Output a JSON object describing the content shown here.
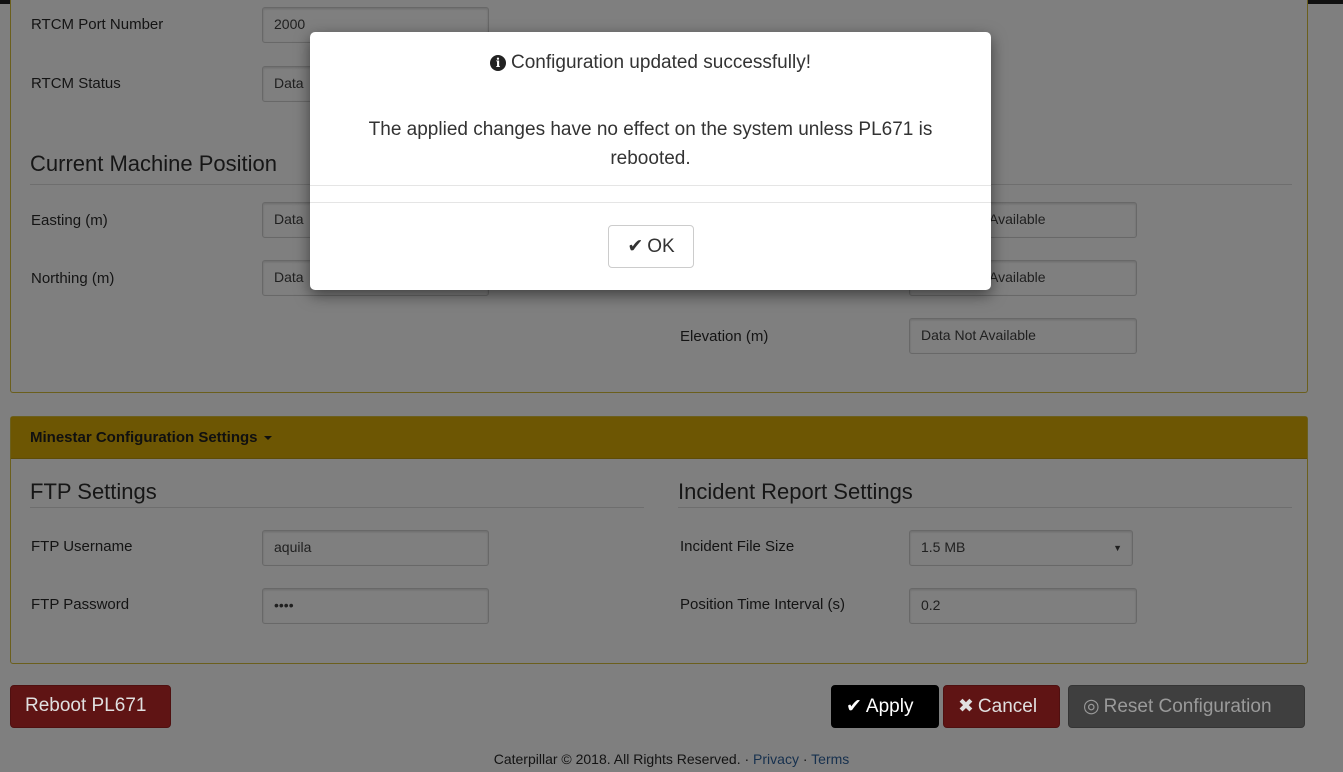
{
  "top_panel": {
    "rtcm_port_label": "RTCM Port Number",
    "rtcm_port_value": "2000",
    "rtcm_status_label": "RTCM Status",
    "rtcm_status_value": "Data",
    "position_title": "Current Machine Position",
    "easting_label": "Easting (m)",
    "easting_value": "Data",
    "northing_label": "Northing (m)",
    "northing_value": "Data",
    "right_value_1": "Available",
    "right_value_2": "Available",
    "elevation_label": "Elevation (m)",
    "elevation_value": "Data Not Available"
  },
  "minestar": {
    "heading": "Minestar Configuration Settings",
    "ftp_title": "FTP Settings",
    "ftp_username_label": "FTP Username",
    "ftp_username_value": "aquila",
    "ftp_password_label": "FTP Password",
    "ftp_password_value": "••••",
    "incident_title": "Incident Report Settings",
    "incident_file_size_label": "Incident File Size",
    "incident_file_size_value": "1.5 MB",
    "position_interval_label": "Position Time Interval (s)",
    "position_interval_value": "0.2"
  },
  "buttons": {
    "reboot": "Reboot PL671",
    "apply": "Apply",
    "cancel": "Cancel",
    "reset": "Reset Configuration"
  },
  "footer": {
    "copyright": "Caterpillar © 2018. All Rights Reserved. · ",
    "privacy": "Privacy",
    "separator": " · ",
    "terms": "Terms"
  },
  "modal": {
    "title": "Configuration updated successfully!",
    "message": "The applied changes have no effect on the system unless PL671 is rebooted.",
    "ok_label": "OK"
  },
  "icons": {
    "info": "info-circle",
    "check": "check",
    "times": "times",
    "reset": "life-ring"
  },
  "colors": {
    "heading_band": "#6d5603",
    "danger": "#5f1414",
    "apply": "#000000",
    "link": "#16304e"
  }
}
